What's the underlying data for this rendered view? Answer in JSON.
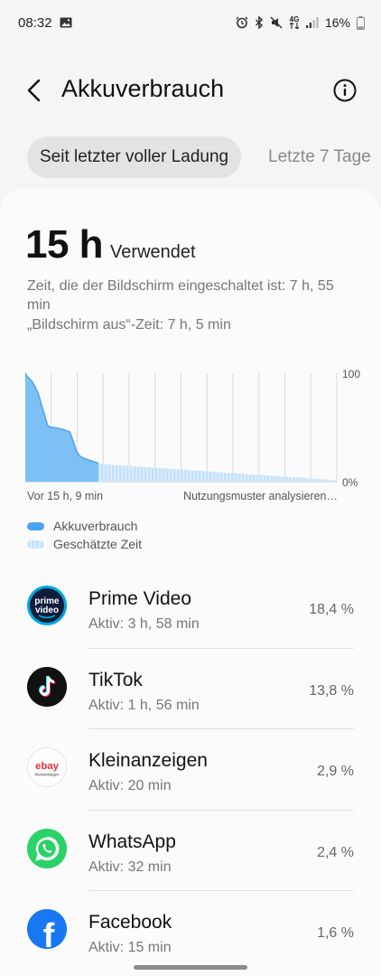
{
  "status_bar": {
    "time": "08:32",
    "battery_percent": "16%",
    "icons": [
      "gallery-icon",
      "alarm-icon",
      "bluetooth-icon",
      "mute-icon",
      "4g-icon",
      "signal-icon",
      "battery-icon"
    ],
    "network_label": "4G"
  },
  "header": {
    "title": "Akkuverbrauch"
  },
  "tabs": [
    {
      "label": "Seit letzter voller Ladung",
      "selected": true
    },
    {
      "label": "Letzte 7 Tage",
      "selected": false
    }
  ],
  "summary": {
    "hours": "15 h",
    "used_label": "Verwendet",
    "screen_on": "Zeit, die der Bildschirm eingeschaltet ist: 7 h, 55 min",
    "screen_off": "„Bildschirm aus“-Zeit: 7 h, 5 min"
  },
  "chart": {
    "start_label": "Vor 15 h, 9 min",
    "end_label": "Nutzungsmuster analysieren…",
    "y_max_label": "100",
    "y_min_label": "0%",
    "usage_color": "#4aa3ee",
    "estimate_color": "#c6e1f8",
    "legend": {
      "usage": "Akkuverbrauch",
      "estimate": "Geschätzte Zeit"
    }
  },
  "chart_data": {
    "type": "area",
    "ylim": [
      0,
      100
    ],
    "series": [
      {
        "name": "Akkuverbrauch",
        "x": [
          0,
          0.3,
          1,
          1.5,
          2,
          2.5,
          3,
          3.5,
          4,
          4.2,
          5,
          6,
          7,
          7.5,
          8,
          8.5,
          9,
          9.5,
          10,
          10.5,
          11,
          11.5
        ],
        "values": [
          100,
          97,
          93,
          88,
          82,
          72,
          62,
          52,
          50,
          50,
          49.5,
          48,
          46,
          38,
          29,
          24,
          22,
          21,
          20,
          19,
          18,
          17
        ]
      },
      {
        "name": "Geschätzte Zeit",
        "x": [
          11.5,
          15,
          20,
          25,
          30,
          35,
          40,
          45,
          49
        ],
        "values": [
          17,
          15,
          13,
          11,
          9,
          7,
          5,
          3,
          1
        ]
      }
    ],
    "xlim": [
      0,
      49
    ]
  },
  "apps": [
    {
      "name": "Prime Video",
      "active": "Aktiv: 3 h, 58 min",
      "percent": "18,4 %",
      "icon": "prime-video-icon"
    },
    {
      "name": "TikTok",
      "active": "Aktiv: 1 h, 56 min",
      "percent": "13,8 %",
      "icon": "tiktok-icon"
    },
    {
      "name": "Kleinanzeigen",
      "active": "Aktiv: 20 min",
      "percent": "2,9 %",
      "icon": "kleinanzeigen-icon"
    },
    {
      "name": "WhatsApp",
      "active": "Aktiv: 32 min",
      "percent": "2,4 %",
      "icon": "whatsapp-icon"
    },
    {
      "name": "Facebook",
      "active": "Aktiv: 15 min",
      "percent": "1,6 %",
      "icon": "facebook-icon"
    }
  ],
  "app_icons": {
    "prime_line1": "prime",
    "prime_line2": "video",
    "ebay_text": "ebay",
    "kleinanzeigen_text": "Kleinanzeigen",
    "facebook_letter": "f"
  }
}
